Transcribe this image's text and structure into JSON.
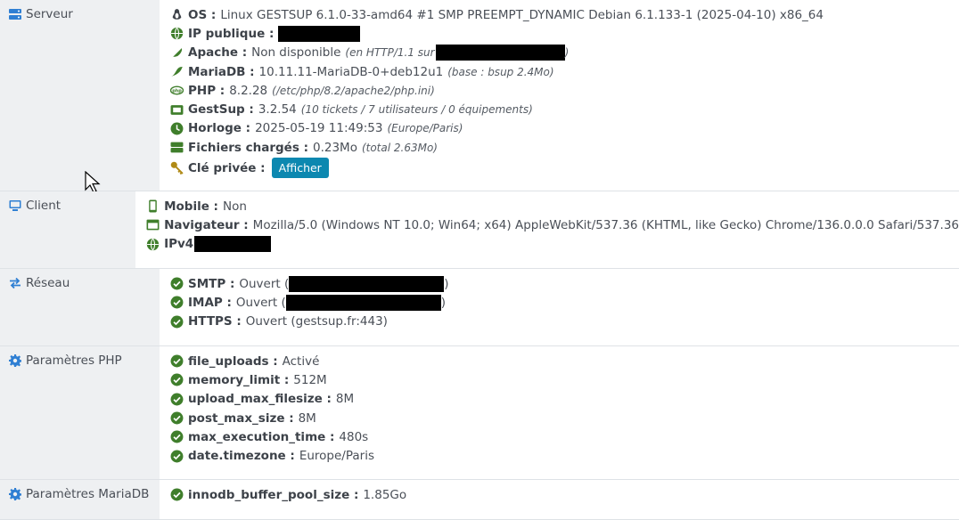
{
  "sections": {
    "serveur": {
      "label": "Serveur",
      "os": {
        "key": "OS :",
        "value": "Linux GESTSUP 6.1.0-33-amd64 #1 SMP PREEMPT_DYNAMIC Debian 6.1.133-1 (2025-04-10) x86_64"
      },
      "ip": {
        "key": "IP publique :"
      },
      "apache": {
        "key": "Apache :",
        "value": "Non disponible",
        "sub_prefix": "(en HTTP/1.1 sur",
        "sub_suffix": ")"
      },
      "mariadb": {
        "key": "MariaDB :",
        "value": "10.11.11-MariaDB-0+deb12u1",
        "sub": "(base : bsup 2.4Mo)"
      },
      "php": {
        "key": "PHP :",
        "value": "8.2.28",
        "sub": "(/etc/php/8.2/apache2/php.ini)"
      },
      "gestsup": {
        "key": "GestSup :",
        "value": "3.2.54",
        "sub": "(10 tickets / 7 utilisateurs / 0 équipements)"
      },
      "horloge": {
        "key": "Horloge :",
        "value": "2025-05-19 11:49:53",
        "sub": "(Europe/Paris)"
      },
      "fichiers": {
        "key": "Fichiers chargés :",
        "value": "0.23Mo",
        "sub": "(total 2.63Mo)"
      },
      "cle": {
        "key": "Clé privée :",
        "button": "Afficher"
      }
    },
    "client": {
      "label": "Client",
      "mobile": {
        "key": "Mobile :",
        "value": "Non"
      },
      "navigateur": {
        "key": "Navigateur :",
        "value": "Mozilla/5.0 (Windows NT 10.0; Win64; x64) AppleWebKit/537.36 (KHTML, like Gecko) Chrome/136.0.0.0 Safari/537.36"
      },
      "ipv4": {
        "key": "IPv4"
      }
    },
    "reseau": {
      "label": "Réseau",
      "smtp": {
        "key": "SMTP :",
        "value": "Ouvert (",
        "suffix": ")"
      },
      "imap": {
        "key": "IMAP :",
        "value": "Ouvert (",
        "suffix": ")"
      },
      "https": {
        "key": "HTTPS :",
        "value": "Ouvert (gestsup.fr:443)"
      }
    },
    "php_params": {
      "label": "Paramètres PHP",
      "items": [
        {
          "key": "file_uploads :",
          "value": "Activé"
        },
        {
          "key": "memory_limit :",
          "value": "512M"
        },
        {
          "key": "upload_max_filesize :",
          "value": "8M"
        },
        {
          "key": "post_max_size :",
          "value": "8M"
        },
        {
          "key": "max_execution_time :",
          "value": "480s"
        },
        {
          "key": "date.timezone :",
          "value": "Europe/Paris"
        }
      ]
    },
    "mariadb_params": {
      "label": "Paramètres MariaDB",
      "items": [
        {
          "key": "innodb_buffer_pool_size :",
          "value": "1.85Go"
        }
      ]
    }
  },
  "colors": {
    "accent": "#2f7fd3",
    "ok": "#3f7e2b",
    "button": "#0c88b0"
  }
}
